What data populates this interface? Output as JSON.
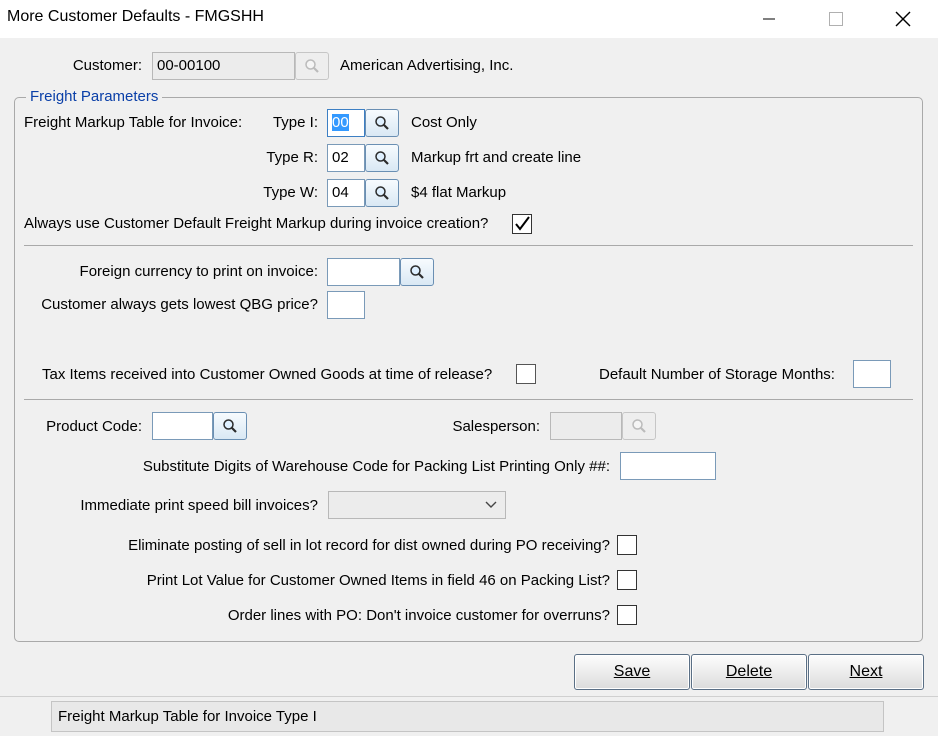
{
  "window": {
    "title": "More Customer Defaults - FMGSHH",
    "minimize_icon": "minimize-icon",
    "maximize_icon": "maximize-icon",
    "close_icon": "close-icon"
  },
  "customer": {
    "label": "Customer:",
    "value": "00-00100",
    "name": "American Advertising, Inc."
  },
  "freight": {
    "legend": "Freight Parameters",
    "table_label": "Freight Markup Table for Invoice:",
    "type_i": {
      "label": "Type I:",
      "value": "00",
      "desc": "Cost Only"
    },
    "type_r": {
      "label": "Type R:",
      "value": "02",
      "desc": "Markup frt and create line"
    },
    "type_w": {
      "label": "Type W:",
      "value": "04",
      "desc": "$4 flat Markup"
    },
    "always_label": "Always use Customer Default Freight Markup during invoice creation?",
    "always_checked": true
  },
  "currency": {
    "foreign_label": "Foreign currency to print on invoice:",
    "foreign_value": "",
    "lowest_label": "Customer always gets lowest QBG price?",
    "lowest_value": "",
    "tax_label": "Tax Items received into Customer Owned Goods at time of release?",
    "tax_checked": false,
    "storage_label": "Default Number of Storage Months:",
    "storage_value": ""
  },
  "misc": {
    "product_label": "Product Code:",
    "product_value": "",
    "salesperson_label": "Salesperson:",
    "salesperson_value": "",
    "substitute_label": "Substitute Digits of Warehouse Code for Packing List Printing Only ##:",
    "substitute_value": "",
    "immediate_label": "Immediate print speed bill invoices?",
    "immediate_value": "",
    "eliminate_label": "Eliminate posting of sell in lot record for dist owned during PO receiving?",
    "eliminate_checked": false,
    "printlot_label": "Print Lot Value for Customer Owned Items in field 46 on Packing List?",
    "printlot_checked": false,
    "orderlines_label": "Order lines with PO: Don't invoice customer for overruns?",
    "orderlines_checked": false
  },
  "buttons": {
    "save": "Save",
    "delete": "Delete",
    "next": "Next"
  },
  "status_bar": {
    "text": "Freight Markup Table for Invoice Type I"
  },
  "colors": {
    "legend": "#0a3fa8",
    "selection": "#3399ff"
  }
}
